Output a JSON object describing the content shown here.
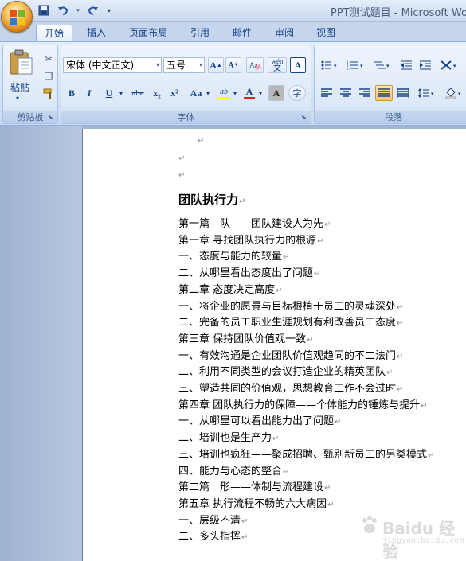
{
  "window": {
    "title": "PPT测试题目 - Microsoft Word"
  },
  "quick_access": {
    "save_icon": "save-icon",
    "undo_icon": "undo-icon",
    "redo_icon": "redo-icon",
    "customize_icon": "chevron-down-icon"
  },
  "tabs": [
    {
      "label": "开始",
      "active": true
    },
    {
      "label": "插入"
    },
    {
      "label": "页面布局"
    },
    {
      "label": "引用"
    },
    {
      "label": "邮件"
    },
    {
      "label": "审阅"
    },
    {
      "label": "视图"
    }
  ],
  "ribbon": {
    "clipboard": {
      "label": "剪贴板",
      "paste_label": "粘贴"
    },
    "font": {
      "label": "字体",
      "font_name": "宋体 (中文正文)",
      "font_size": "五号",
      "grow_label": "A",
      "shrink_label": "A",
      "bold": "B",
      "italic": "I",
      "underline": "U",
      "strike": "abe",
      "subscript": "x₂",
      "superscript": "x²",
      "case": "Aa",
      "wen": "wén",
      "char_border": "A",
      "shading": "A",
      "enclose": "字",
      "font_color": "A",
      "highlight": "ab"
    },
    "paragraph": {
      "label": "段落"
    }
  },
  "document": {
    "heading": "团队执行力",
    "lines": [
      "第一篇　队——团队建设人为先",
      "第一章 寻找团队执行力的根源",
      "一、态度与能力的较量",
      "二、从哪里看出态度出了问题",
      "第二章 态度决定高度",
      "一、将企业的愿景与目标根植于员工的灵魂深处",
      "二、完备的员工职业生涯规划有利改善员工态度",
      "第三章 保持团队价值观一致",
      "一、有效沟通是企业团队价值观趋同的不二法门",
      "二、利用不同类型的会议打造企业的精英团队",
      "三、塑造共同的价值观，思想教育工作不会过时",
      "第四章 团队执行力的保障——个体能力的锤炼与提升",
      "一、从哪里可以看出能力出了问题",
      "二、培训也是生产力",
      "三、培训也疯狂——聚成招聘、甄别新员工的另类模式",
      "四、能力与心态的整合",
      "第二篇　形——体制与流程建设",
      "第五章 执行流程不畅的六大病因",
      "一、层级不清",
      "二、多头指挥"
    ],
    "paragraph_mark": "↵"
  },
  "watermark": {
    "main": "Baidu 经验",
    "sub": "jingyan.baidu.com"
  },
  "colors": {
    "ribbon_text": "#15428b",
    "tab_bg": "#c4d5ec",
    "font_color_bar": "#e02020",
    "highlight_bar": "#ffff00"
  }
}
